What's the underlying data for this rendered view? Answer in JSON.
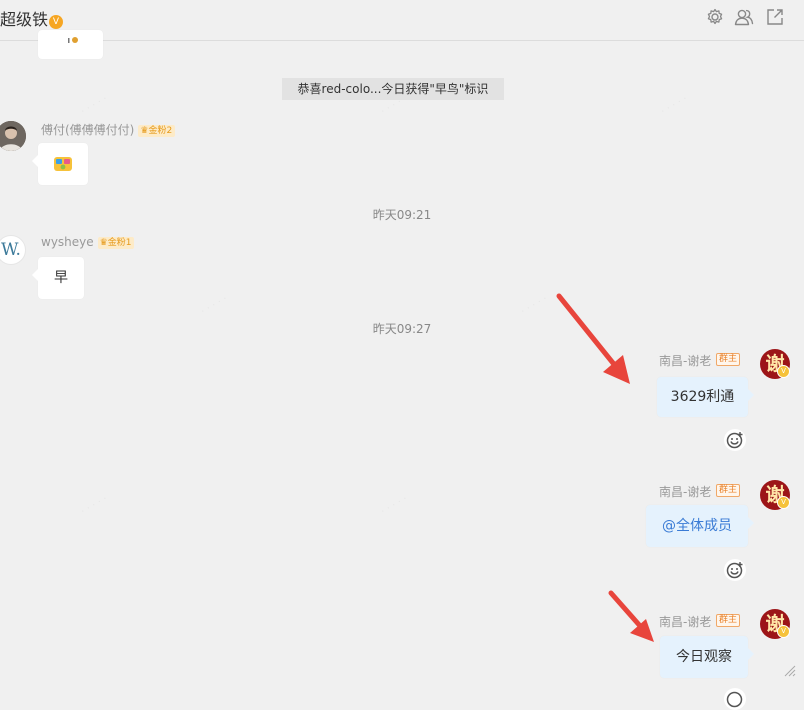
{
  "header": {
    "group_name": "超级铁",
    "title_badge": "V",
    "settings_icon": "gear-icon",
    "members_icon": "members-icon",
    "popout_icon": "external-link-icon"
  },
  "system_message": "恭喜red-colo...今日获得\"早鸟\"标识",
  "messages": [
    {
      "sender": "傅付(傅傅傅付付)",
      "badge": "金粉2",
      "content": "emoji-sticker"
    },
    {
      "sender": "wysheye",
      "badge": "金粉1",
      "avatar_text": "W.",
      "text": "早"
    }
  ],
  "timestamps": [
    "昨天09:21",
    "昨天09:27"
  ],
  "my_messages": [
    {
      "sender": "南昌-谢老",
      "role": "群主",
      "avatar_text": "谢",
      "text": "3629利通"
    },
    {
      "sender": "南昌-谢老",
      "role": "群主",
      "avatar_text": "谢",
      "text": "@全体成员"
    },
    {
      "sender": "南昌-谢老",
      "role": "群主",
      "avatar_text": "谢",
      "text": "今日观察"
    }
  ],
  "colors": {
    "background": "#f0f0f0",
    "my_bubble": "#e5f2fd",
    "arrow": "#e8453c",
    "owner_badge": "#e8822c",
    "fan_badge": "#e69a1b"
  }
}
